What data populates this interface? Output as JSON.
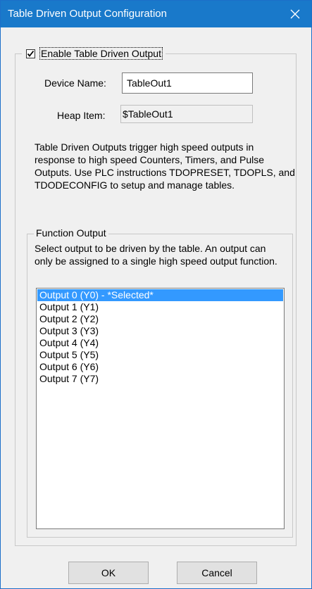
{
  "window": {
    "title": "Table Driven Output Configuration"
  },
  "enable": {
    "label": "Enable Table Driven Output",
    "checked": true
  },
  "device_name": {
    "label": "Device Name:",
    "value": "TableOut1"
  },
  "heap_item": {
    "label": "Heap Item:",
    "value": "$TableOut1"
  },
  "description": "Table Driven Outputs trigger high speed outputs in response to high speed Counters, Timers, and Pulse Outputs. Use PLC instructions TDOPRESET, TDOPLS, and TDODECONFIG to setup and manage tables.",
  "function_output": {
    "legend": "Function Output",
    "description": "Select output to be driven by the table. An output can only be assigned to a single high speed output function.",
    "items": [
      {
        "label": "Output 0 (Y0) - *Selected*",
        "selected": true
      },
      {
        "label": "Output 1 (Y1)",
        "selected": false
      },
      {
        "label": "Output 2 (Y2)",
        "selected": false
      },
      {
        "label": "Output 3 (Y3)",
        "selected": false
      },
      {
        "label": "Output 4 (Y4)",
        "selected": false
      },
      {
        "label": "Output 5 (Y5)",
        "selected": false
      },
      {
        "label": "Output 6 (Y6)",
        "selected": false
      },
      {
        "label": "Output 7 (Y7)",
        "selected": false
      }
    ]
  },
  "buttons": {
    "ok": "OK",
    "cancel": "Cancel"
  },
  "colors": {
    "titlebar": "#1979ca",
    "selection": "#3399ff",
    "dialog_bg": "#f0f0f0"
  },
  "icons": {
    "close": "close-icon",
    "check": "checkmark-icon"
  }
}
